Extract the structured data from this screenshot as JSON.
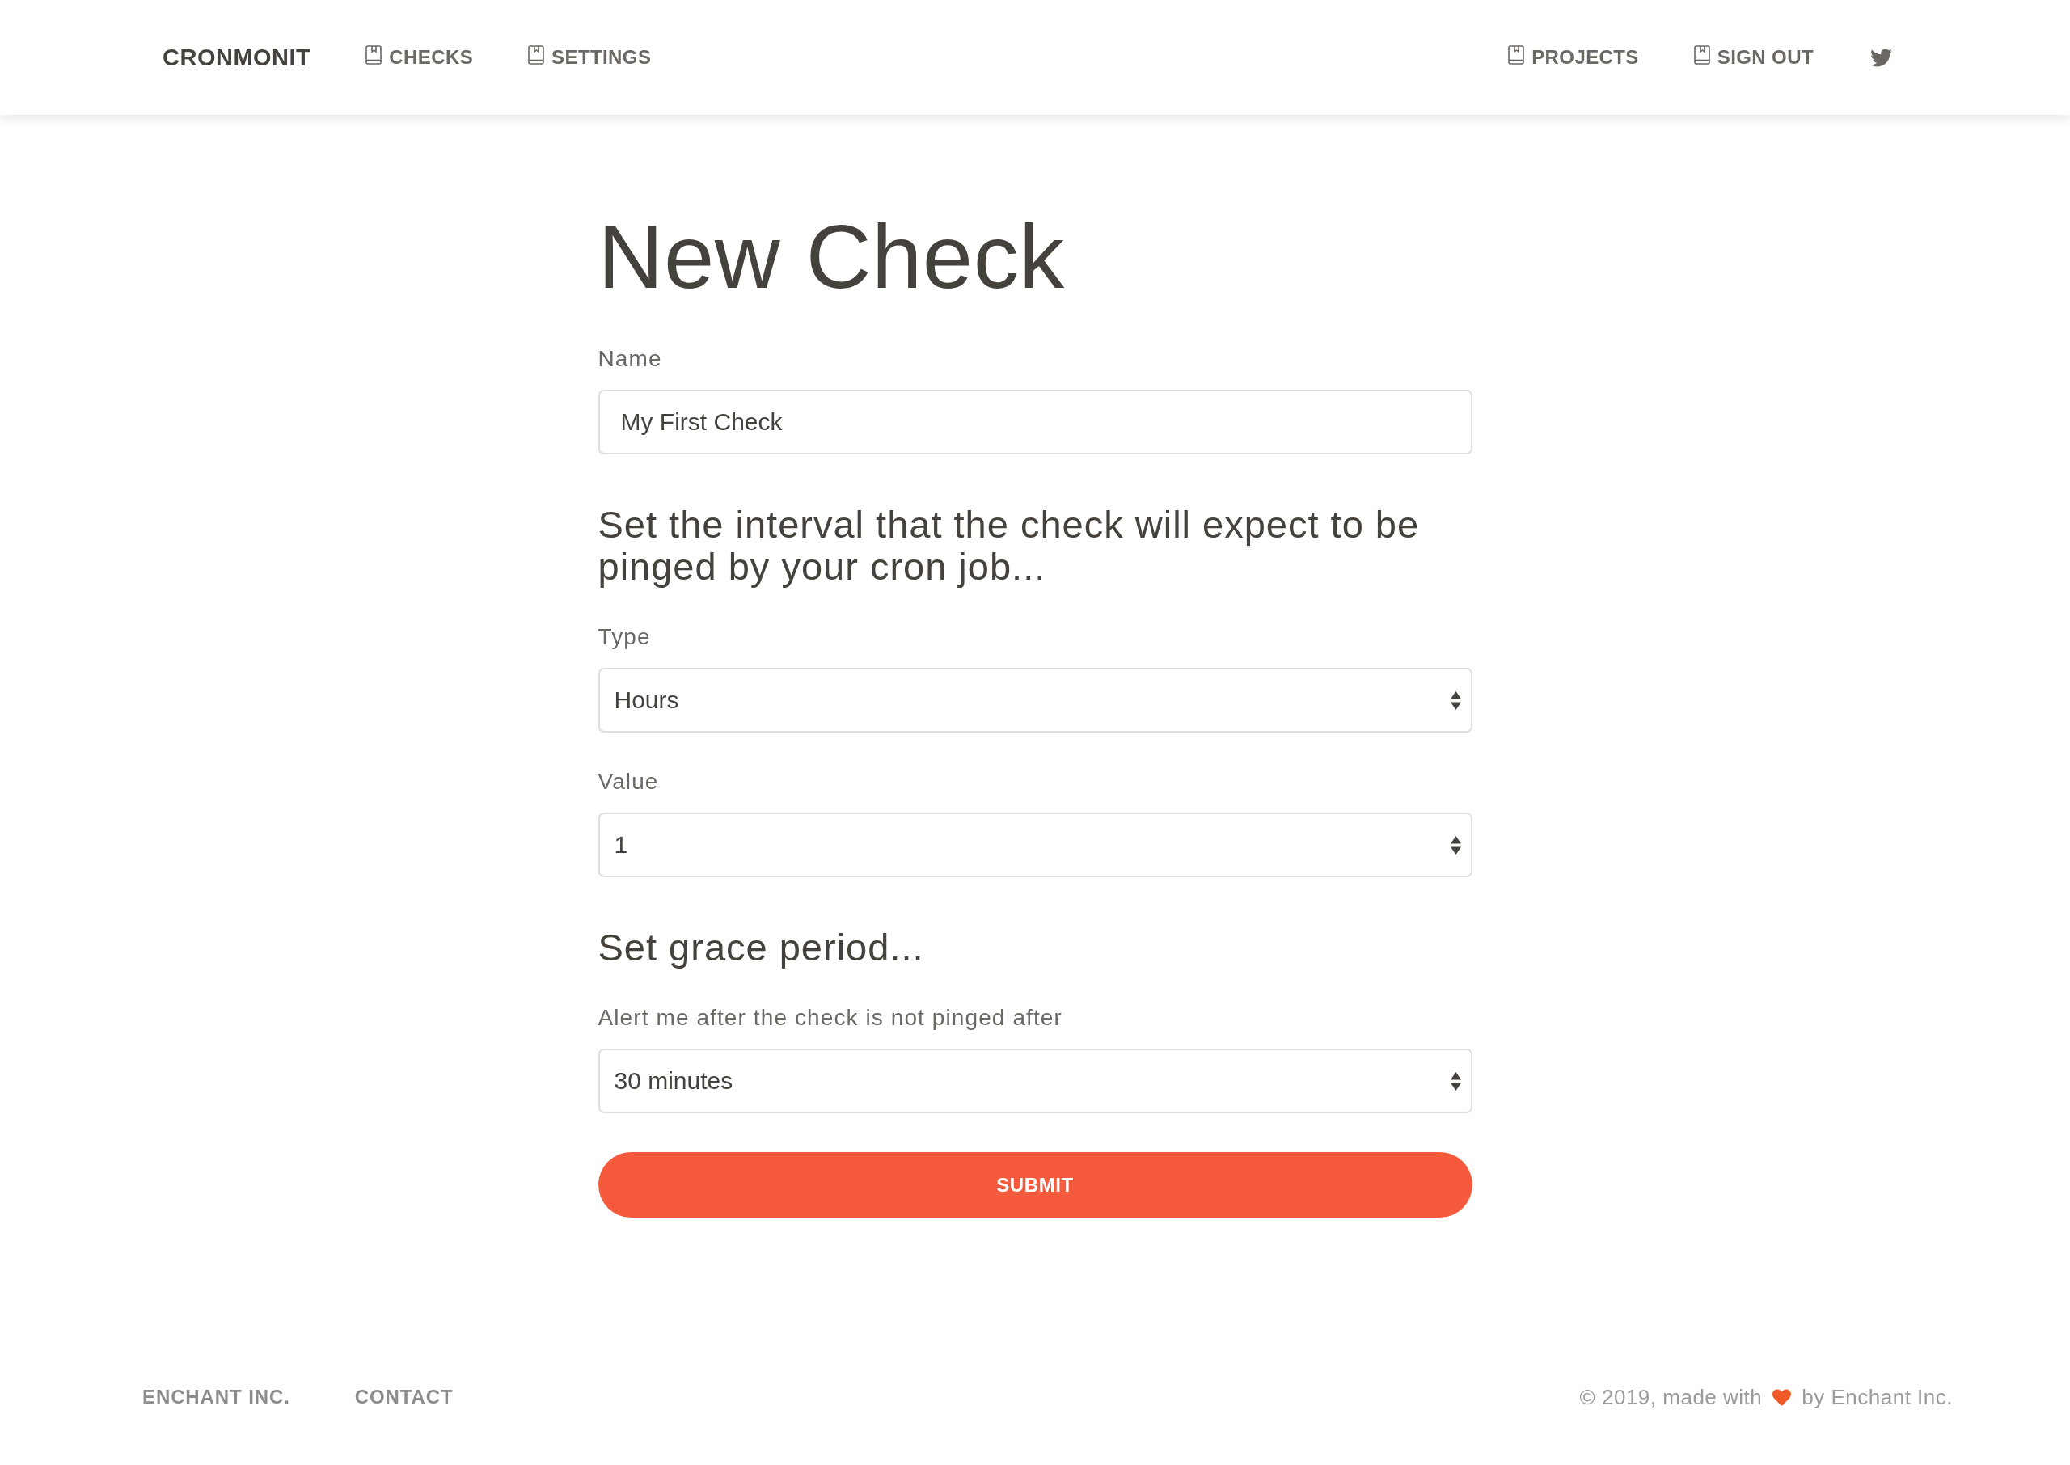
{
  "header": {
    "logo": "CRONMONIT",
    "nav_left": [
      {
        "label": "CHECKS"
      },
      {
        "label": "SETTINGS"
      }
    ],
    "nav_right": [
      {
        "label": "PROJECTS"
      },
      {
        "label": "SIGN OUT"
      }
    ]
  },
  "form": {
    "title": "New Check",
    "items": [
      {
        "kind": "input",
        "label": "Name",
        "value": "My First Check"
      },
      {
        "kind": "heading",
        "text": "Set the interval that the check will expect to be pinged by your cron job..."
      },
      {
        "kind": "select",
        "label": "Type",
        "value": "Hours"
      },
      {
        "kind": "select",
        "label": "Value",
        "value": "1"
      },
      {
        "kind": "heading",
        "text": "Set grace period..."
      },
      {
        "kind": "select",
        "label": "Alert me after the check is not pinged after",
        "value": "30 minutes"
      }
    ],
    "submit": "SUBMIT"
  },
  "footer": {
    "links": [
      "ENCHANT INC.",
      "CONTACT"
    ],
    "credit": {
      "before": "© 2019, made with",
      "after": "by Enchant Inc."
    }
  }
}
